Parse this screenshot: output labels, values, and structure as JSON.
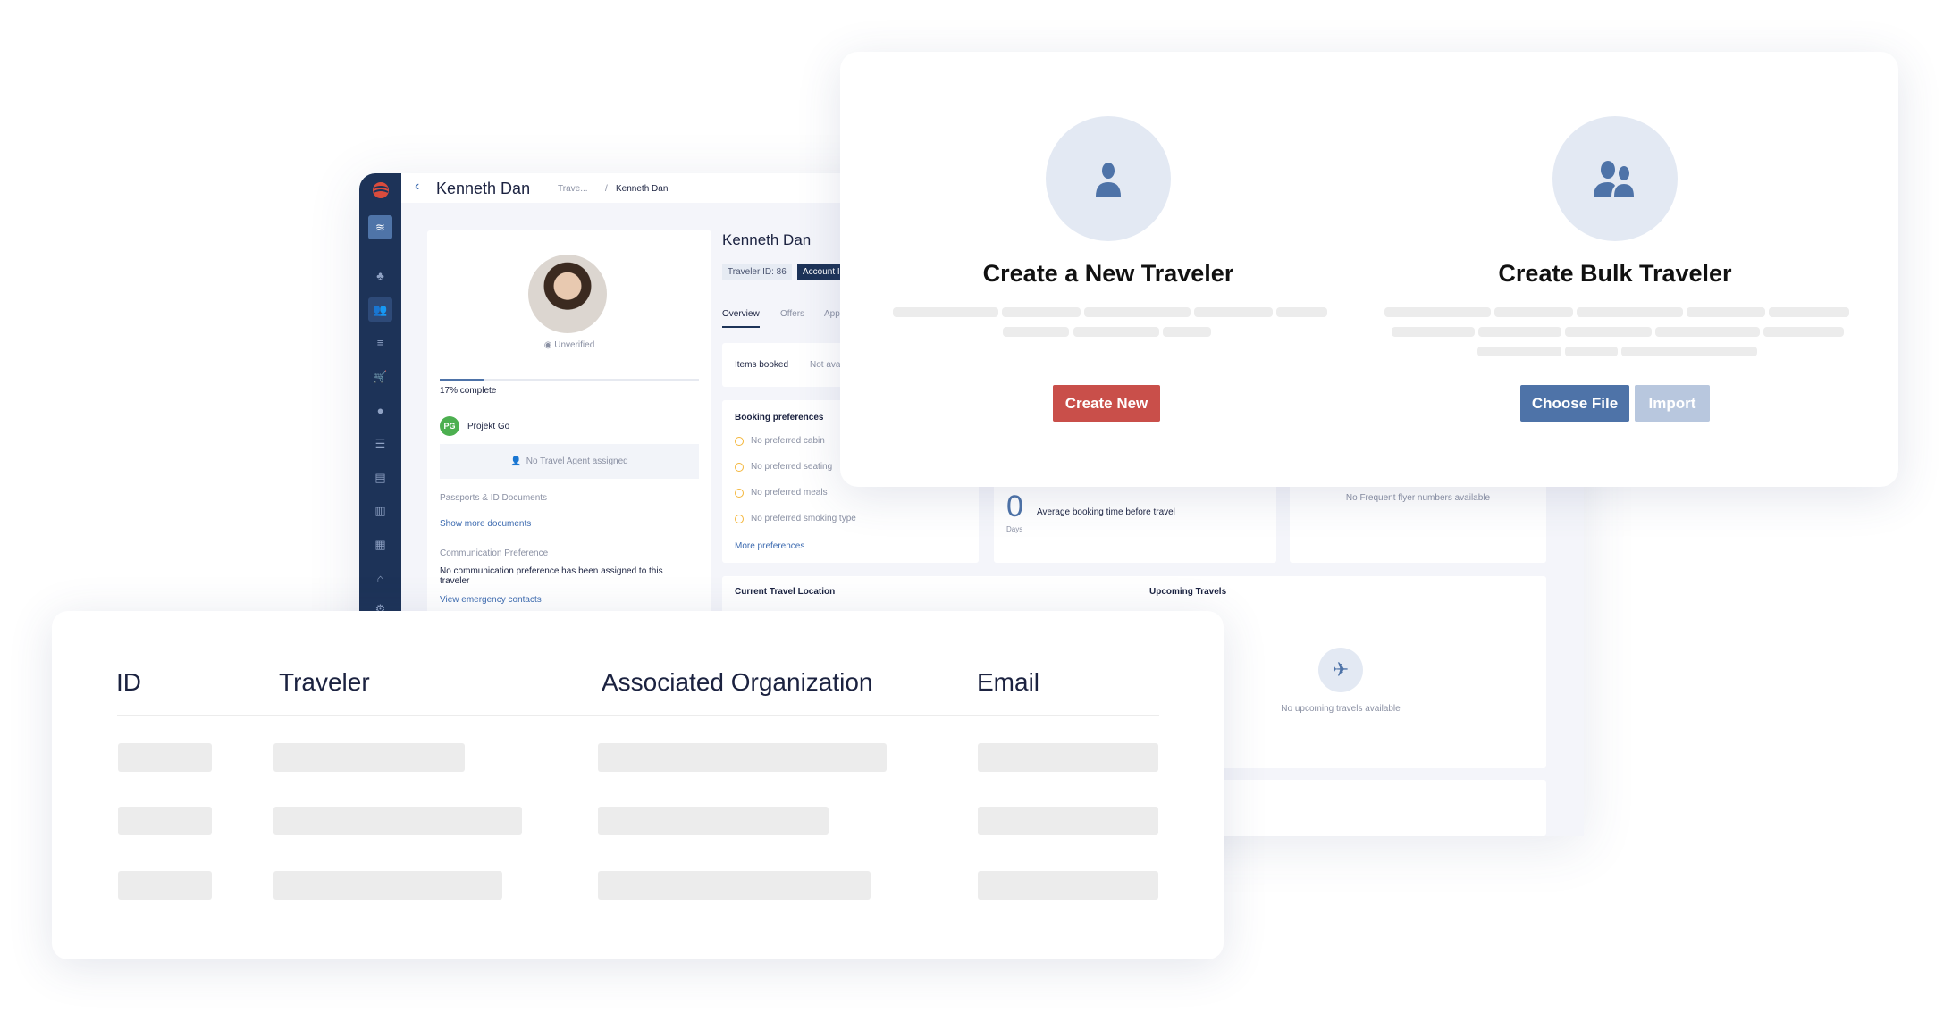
{
  "app": {
    "header": {
      "title": "Kenneth Dan",
      "breadcrumb_parent": "Trave...",
      "breadcrumb_sep": "/",
      "breadcrumb_current": "Kenneth Dan"
    },
    "profile": {
      "verification": "Unverified",
      "progress_percent": 17,
      "progress_label": "17% complete",
      "org_initials": "PG",
      "org_name": "Projekt Go",
      "agent_text": "No Travel Agent assigned",
      "passports_label": "Passports & ID Documents",
      "show_more_documents": "Show more documents",
      "comm_pref_label": "Communication Preference",
      "comm_pref_text": "No communication preference has been assigned to this traveler",
      "emergency_link": "View emergency contacts"
    },
    "traveler": {
      "name": "Kenneth Dan",
      "id_badge": "Traveler ID: 86",
      "account_badge": "Account I",
      "tabs": [
        "Overview",
        "Offers",
        "App"
      ],
      "items_booked_label": "Items booked",
      "items_booked_value": "Not ava",
      "booking_prefs_title": "Booking preferences",
      "prefs": [
        "No preferred cabin",
        "No preferred seating",
        "No preferred meals",
        "No preferred smoking type"
      ],
      "more_prefs": "More preferences",
      "avg_value": "0",
      "avg_unit": "Days",
      "avg_label": "Average booking time before travel",
      "ff_text": "No Frequent flyer numbers available",
      "location_title": "Current Travel Location",
      "upcoming_title": "Upcoming Travels",
      "upcoming_empty": "No upcoming travels available"
    }
  },
  "modal": {
    "new": {
      "title": "Create a New Traveler",
      "button": "Create New",
      "icon": "person-icon"
    },
    "bulk": {
      "title": "Create Bulk Traveler",
      "choose_button": "Choose File",
      "import_button": "Import",
      "icon": "people-icon"
    }
  },
  "table": {
    "headers": [
      "ID",
      "Traveler",
      "Associated Organization",
      "Email"
    ]
  },
  "colors": {
    "primary": "#4e73a8",
    "danger": "#c94f4a",
    "sidebar": "#1d3358",
    "success": "#4caf50"
  }
}
